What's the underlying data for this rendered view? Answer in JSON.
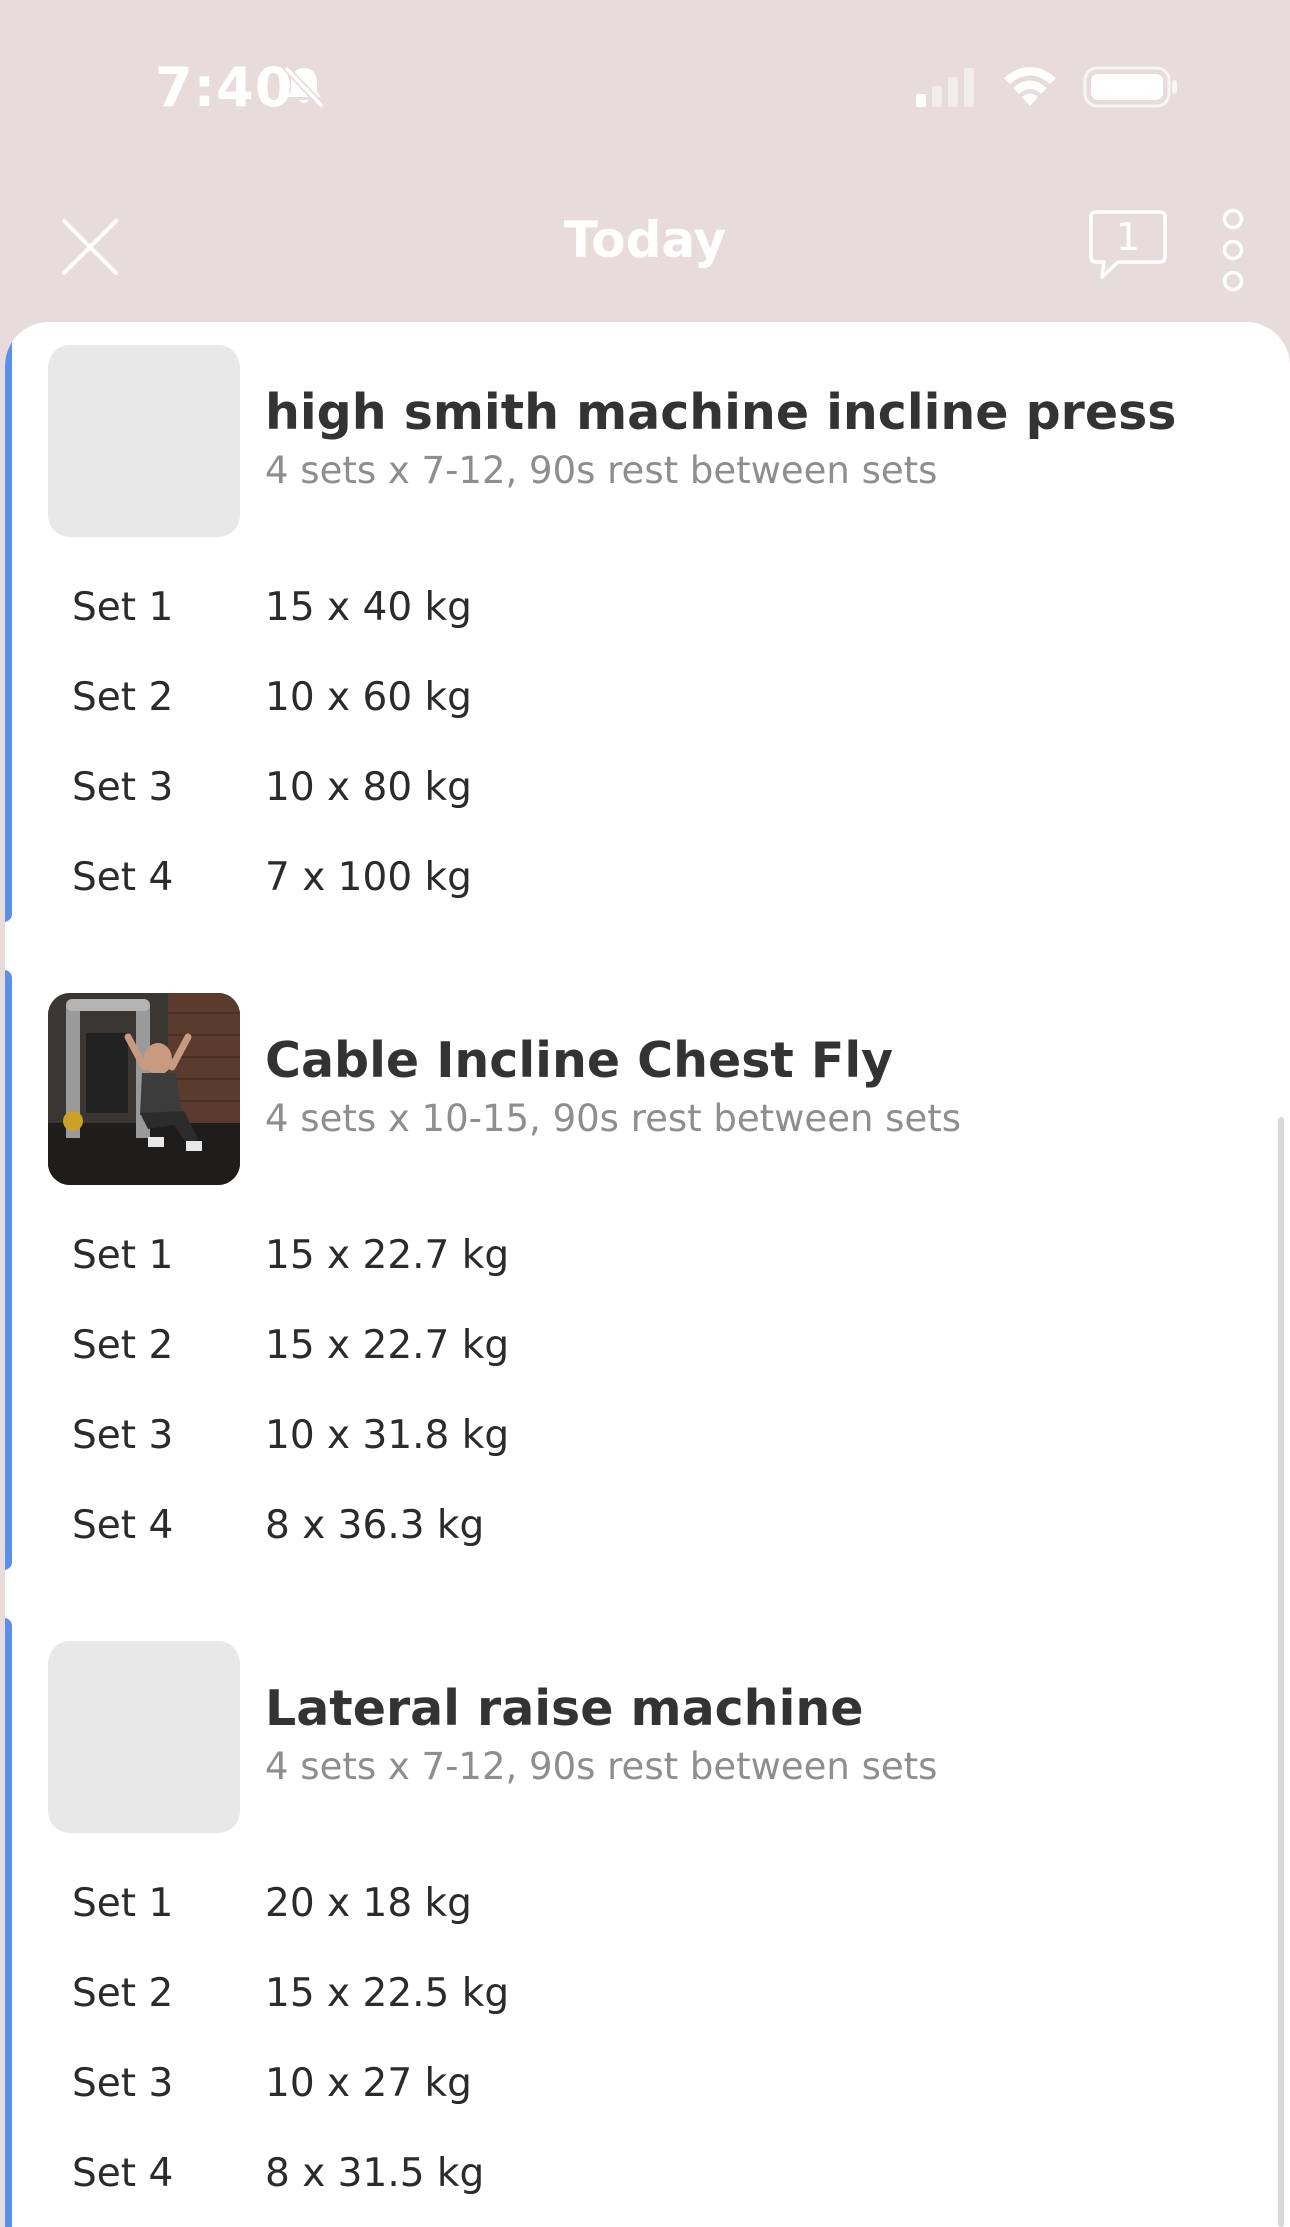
{
  "status_bar": {
    "time": "7:40",
    "icons": [
      "bell-slash-icon",
      "cellular-signal-icon",
      "wifi-icon",
      "battery-icon"
    ]
  },
  "nav": {
    "title": "Today",
    "comment_count": "1",
    "icons": [
      "close-icon",
      "comment-icon",
      "more-vertical-icon"
    ]
  },
  "exercises": [
    {
      "title": "high smith machine incline press",
      "subtitle": "4 sets x 7-12, 90s rest between sets",
      "thumbnail": "placeholder",
      "sets": [
        {
          "label": "Set 1",
          "value": "15 x 40 kg"
        },
        {
          "label": "Set 2",
          "value": "10 x 60 kg"
        },
        {
          "label": "Set 3",
          "value": "10 x 80 kg"
        },
        {
          "label": "Set 4",
          "value": "7 x 100 kg"
        }
      ]
    },
    {
      "title": "Cable Incline Chest Fly",
      "subtitle": "4 sets x 10-15, 90s rest between sets",
      "thumbnail": "exercise-photo",
      "sets": [
        {
          "label": "Set 1",
          "value": "15 x 22.7 kg"
        },
        {
          "label": "Set 2",
          "value": "15 x 22.7 kg"
        },
        {
          "label": "Set 3",
          "value": "10 x 31.8 kg"
        },
        {
          "label": "Set 4",
          "value": "8 x 36.3 kg"
        }
      ]
    },
    {
      "title": "Lateral raise machine",
      "subtitle": "4 sets x 7-12, 90s rest between sets",
      "thumbnail": "placeholder",
      "sets": [
        {
          "label": "Set 1",
          "value": "20 x 18 kg"
        },
        {
          "label": "Set 2",
          "value": "15 x 22.5 kg"
        },
        {
          "label": "Set 3",
          "value": "10 x 27 kg"
        },
        {
          "label": "Set 4",
          "value": "8 x 31.5 kg"
        }
      ]
    }
  ],
  "colors": {
    "header_background": "#e7dcdb",
    "accent": "#5b8fea",
    "placeholder": "#e8e8e8",
    "subtitle": "#8e8e8e"
  }
}
